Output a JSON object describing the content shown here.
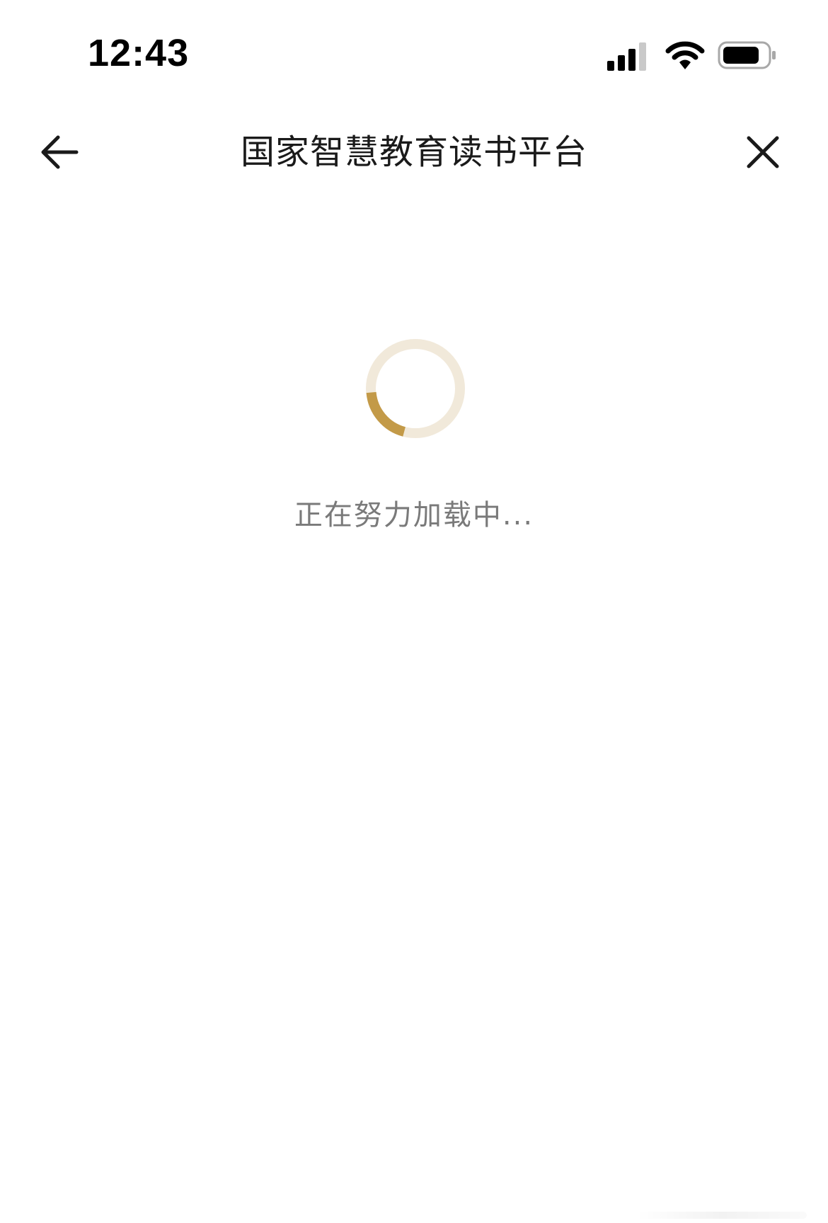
{
  "status_bar": {
    "time": "12:43",
    "icons": [
      "cellular-signal-icon",
      "wifi-icon",
      "battery-icon"
    ]
  },
  "nav": {
    "title": "国家智慧教育读书平台",
    "back_icon": "arrow-left-icon",
    "close_icon": "close-icon"
  },
  "loading": {
    "text": "正在努力加载中...",
    "spinner_track_color": "#F1E9DA",
    "spinner_arc_color": "#C39A48"
  },
  "colors": {
    "background": "#FFFFFF",
    "title_text": "#1A1A1A",
    "loading_text": "#7A7A7A"
  }
}
